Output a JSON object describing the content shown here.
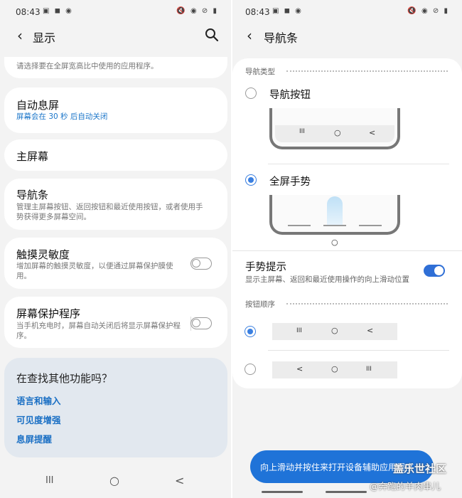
{
  "left": {
    "status_time": "08:43",
    "status_left_icons": "▣ ◼ ◉",
    "status_right_icons": "🔇 ◉ ⊘ ▮",
    "header_title": "显示",
    "top_hint": "请选择要在全屏宽高比中使用的应用程序。",
    "items": [
      {
        "title": "自动息屏",
        "subtitle": "屏幕会在 30 秒 后自动关闭"
      },
      {
        "title": "主屏幕"
      },
      {
        "title": "导航条",
        "subtitle": "管理主屏幕按钮、返回按钮和最近使用按钮，或者使用手势获得更多屏幕空间。"
      },
      {
        "title": "触摸灵敏度",
        "subtitle": "增加屏幕的触摸灵敏度，以便通过屏幕保护膜使用。",
        "toggle": false
      },
      {
        "title": "屏幕保护程序",
        "subtitle": "当手机充电时，屏幕自动关闭后将显示屏幕保护程序。",
        "toggle": false
      }
    ],
    "find_more": {
      "heading": "在查找其他功能吗？",
      "links": [
        "语言和输入",
        "可见度增强",
        "息屏提醒"
      ]
    },
    "nav": {
      "recents": "III",
      "home": "○",
      "back": "<"
    }
  },
  "right": {
    "status_time": "08:43",
    "status_left_icons": "▣ ◼ ◉",
    "status_right_icons": "🔇 ◉ ⊘ ▮",
    "header_title": "导航条",
    "nav_type_label": "导航类型",
    "option_buttons": "导航按钮",
    "option_gestures": "全屏手势",
    "selected_option": "全屏手势",
    "gesture_hint_title": "手势提示",
    "gesture_hint_desc": "显示主屏幕、返回和最近使用操作的向上滑动位置",
    "gesture_hint_on": true,
    "button_order_label": "按钮顺序",
    "order1": [
      "III",
      "○",
      "<"
    ],
    "order2": [
      "<",
      "○",
      "III"
    ],
    "selected_order": 1,
    "tooltip": "向上滑动并按住来打开设备辅助应用程序",
    "watermark_1": "盖乐世社区",
    "watermark_2": "@奔跑的羊肉串儿"
  },
  "colors": {
    "accent": "#1a75c9",
    "toggle_on": "#2f6fd6",
    "tooltip_bg": "#1f73d8",
    "find_bg": "#e2e8ef"
  }
}
